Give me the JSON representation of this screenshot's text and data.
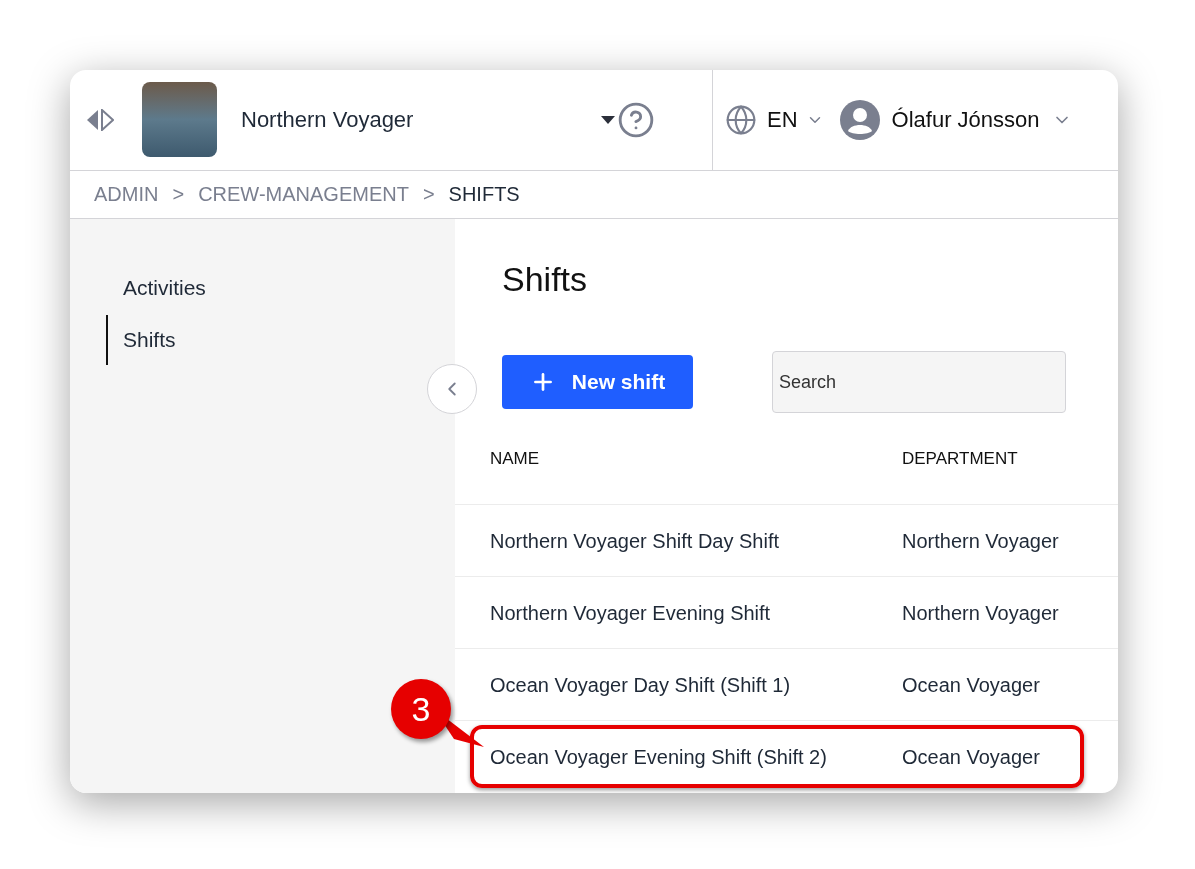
{
  "header": {
    "vessel_name": "Northern Voyager",
    "language": "EN",
    "user_name": "Ólafur Jónsson"
  },
  "breadcrumb": [
    {
      "label": "ADMIN",
      "current": false
    },
    {
      "label": ">"
    },
    {
      "label": "CREW-MANAGEMENT",
      "current": false
    },
    {
      "label": ">"
    },
    {
      "label": "SHIFTS",
      "current": true
    }
  ],
  "sidebar": {
    "items": [
      {
        "label": "Activities",
        "selected": false
      },
      {
        "label": "Shifts",
        "selected": true
      }
    ]
  },
  "page": {
    "title": "Shifts",
    "new_button": "New shift",
    "search": {
      "placeholder": "Search"
    }
  },
  "table": {
    "columns": [
      "NAME",
      "DEPARTMENT"
    ],
    "rows": [
      {
        "name": "Northern Voyager Shift Day Shift",
        "department": "Northern Voyager",
        "highlighted": false
      },
      {
        "name": "Northern Voyager Evening Shift",
        "department": "Northern Voyager",
        "highlighted": false
      },
      {
        "name": "Ocean Voyager Day Shift (Shift 1)",
        "department": "Ocean Voyager",
        "highlighted": false
      },
      {
        "name": "Ocean Voyager Evening Shift (Shift 2)",
        "department": "Ocean Voyager",
        "highlighted": true
      }
    ]
  },
  "annotation": {
    "number": "3"
  }
}
